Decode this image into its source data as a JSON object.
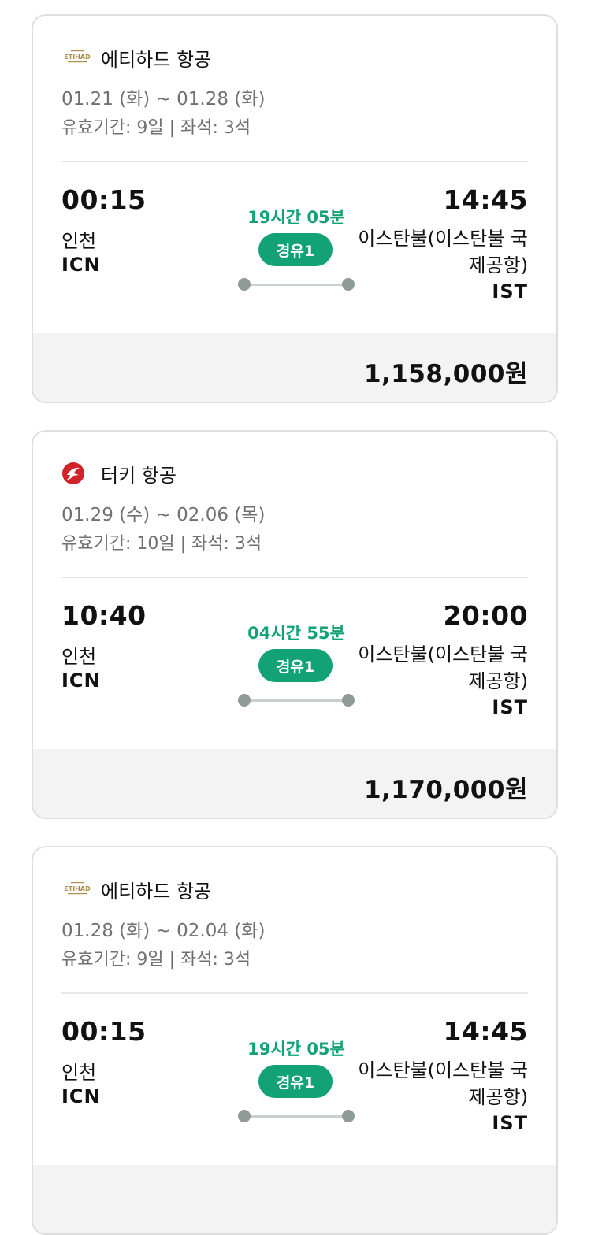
{
  "flights": [
    {
      "airline": "에티하드 항공",
      "logo_icon": "etihad-logo",
      "dates": "01.21 (화) ~ 01.28 (화)",
      "validity": "유효기간: 9일 | 좌석: 3석",
      "departure": {
        "time": "00:15",
        "city": "인천",
        "code": "ICN"
      },
      "duration": "19시간 05분",
      "stops": "경유1",
      "arrival": {
        "time": "14:45",
        "city": "이스탄불(이스탄불 국제공항)",
        "code": "IST"
      },
      "price": "1,158,000원"
    },
    {
      "airline": "터키 항공",
      "logo_icon": "turkish-airlines-logo",
      "dates": "01.29 (수) ~ 02.06 (목)",
      "validity": "유효기간: 10일 | 좌석: 3석",
      "departure": {
        "time": "10:40",
        "city": "인천",
        "code": "ICN"
      },
      "duration": "04시간 55분",
      "stops": "경유1",
      "arrival": {
        "time": "20:00",
        "city": "이스탄불(이스탄불 국제공항)",
        "code": "IST"
      },
      "price": "1,170,000원"
    },
    {
      "airline": "에티하드 항공",
      "logo_icon": "etihad-logo",
      "dates": "01.28 (화) ~ 02.04 (화)",
      "validity": "유효기간: 9일 | 좌석: 3석",
      "departure": {
        "time": "00:15",
        "city": "인천",
        "code": "ICN"
      },
      "duration": "19시간 05분",
      "stops": "경유1",
      "arrival": {
        "time": "14:45",
        "city": "이스탄불(이스탄불 국제공항)",
        "code": "IST"
      },
      "price": ""
    }
  ],
  "colors": {
    "accent_green": "#12a275",
    "etihad_gold": "#b08d4a",
    "turkish_red": "#d2232a"
  }
}
